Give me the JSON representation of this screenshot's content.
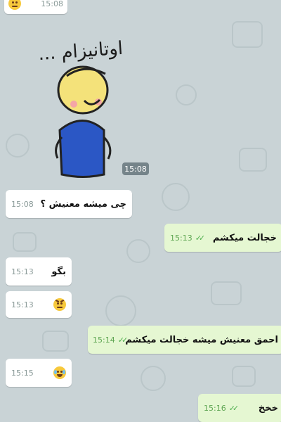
{
  "sticker": {
    "caption": "اوتانیزام ...",
    "time": "15:08"
  },
  "top_partial": {
    "time": "15:08",
    "icon": "emoji-icon"
  },
  "messages": [
    {
      "direction": "in",
      "text": "چی میشه معنیش ؟",
      "time": "15:08"
    },
    {
      "direction": "out",
      "text": "خجالت میکشم",
      "time": "15:13",
      "status": "read"
    },
    {
      "direction": "in",
      "text": "بگو",
      "time": "15:13"
    },
    {
      "direction": "in",
      "text": "",
      "emoji": "angry-face-icon",
      "time": "15:13"
    },
    {
      "direction": "out",
      "text": "احمق معنیش میشه خجالت میکشم",
      "time": "15:14",
      "status": "read"
    },
    {
      "direction": "in",
      "text": "",
      "emoji": "laughing-tears-icon",
      "time": "15:15"
    },
    {
      "direction": "out",
      "text": "خخخ",
      "time": "15:16",
      "status": "read"
    }
  ],
  "colors": {
    "background": "#c9d3d6",
    "incoming_bubble": "#ffffff",
    "outgoing_bubble": "#e5f7d2",
    "read_ticks": "#4fae4e"
  }
}
